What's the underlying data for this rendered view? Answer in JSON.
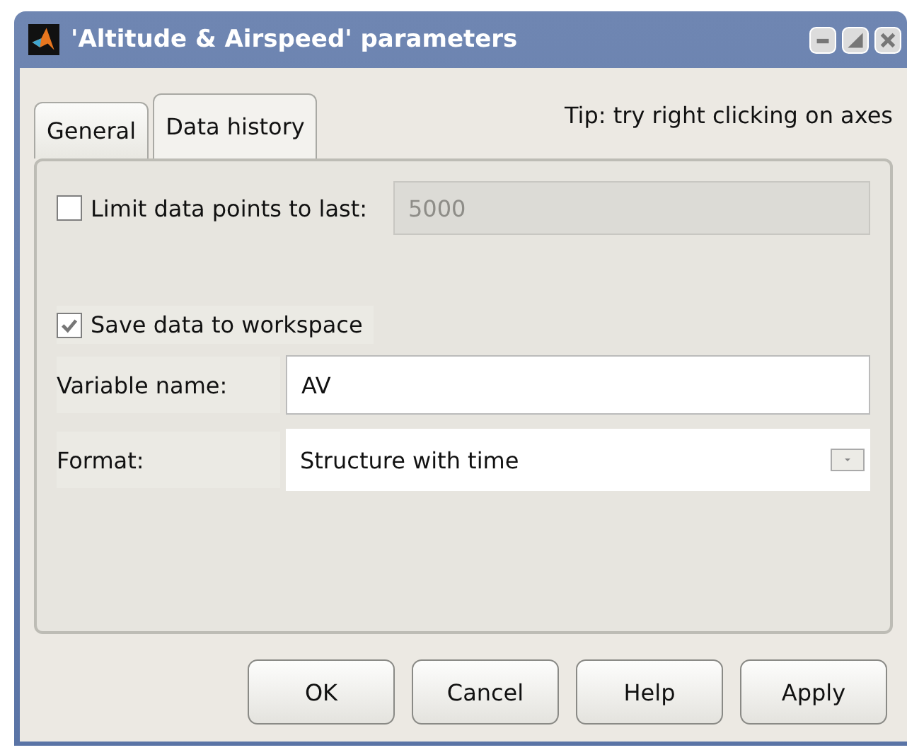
{
  "window": {
    "title": "'Altitude & Airspeed' parameters"
  },
  "tabs": [
    {
      "label": "General",
      "selected": false
    },
    {
      "label": "Data history",
      "selected": true
    }
  ],
  "tip": "Tip: try right clicking on axes",
  "limit": {
    "label": "Limit data points to last:",
    "checked": false,
    "value": "5000",
    "disabled": true
  },
  "save": {
    "label": "Save data to workspace",
    "checked": true
  },
  "variable": {
    "label": "Variable name:",
    "value": "AV"
  },
  "format": {
    "label": "Format:",
    "value": "Structure with time"
  },
  "buttons": [
    "OK",
    "Cancel",
    "Help",
    "Apply"
  ]
}
